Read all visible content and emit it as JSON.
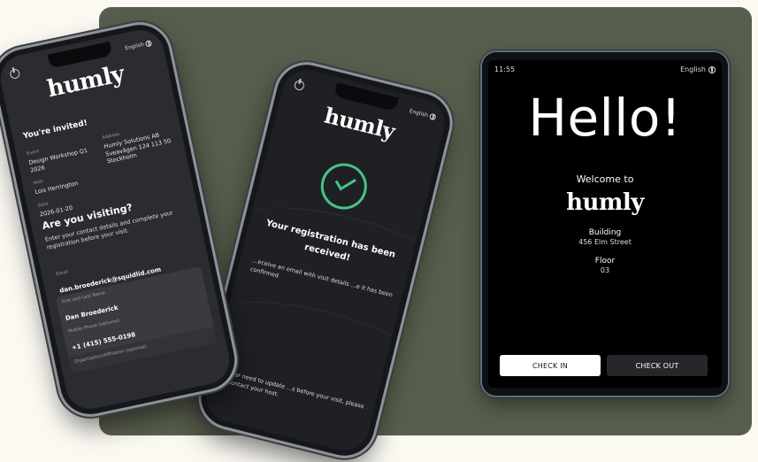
{
  "phone1": {
    "language": "English",
    "logo": "humly",
    "invited": "You're invited!",
    "event_label": "Event",
    "event_value": "Design Workshop Q1 2026",
    "address_label": "Address",
    "address_value": "Humly Solutions AB Sveavägen 124 113 50 Stockholm",
    "host_label": "Host",
    "host_value": "Lois Herrington",
    "date_label": "Date",
    "date_value": "2026-01-20",
    "visiting_title": "Are you visiting?",
    "visiting_desc": "Enter your contact details and complete your registration before your visit.",
    "email_label": "Email",
    "email_value": "dan.broederick@squidlid.com",
    "name_label": "First and Last Name",
    "name_value": "Dan Broederick",
    "phone_label": "Mobile Phone (optional)",
    "phone_value": "+1 (415) 555-0198",
    "org_label": "Organization/Affiliation (optional)"
  },
  "phone2": {
    "language": "English",
    "logo": "humly",
    "title": "Your registration has been received!",
    "desc": "...eceive an email with visit details ...e it has been confirmed",
    "footer": "...s or need to update ...s before your visit, please ...contact your host."
  },
  "tablet": {
    "time": "11:55",
    "language": "English",
    "hello": "Hello!",
    "welcome": "Welcome to",
    "logo": "humly",
    "building_label": "Building",
    "building_value": "456 Elm Street",
    "floor_label": "Floor",
    "floor_value": "03",
    "check_in": "CHECK IN",
    "check_out": "CHECK OUT"
  },
  "colors": {
    "page_bg": "#fbf9f2",
    "stage_bg": "#585e4d",
    "success": "#47c388",
    "phone_screen": "#2b2c30"
  }
}
